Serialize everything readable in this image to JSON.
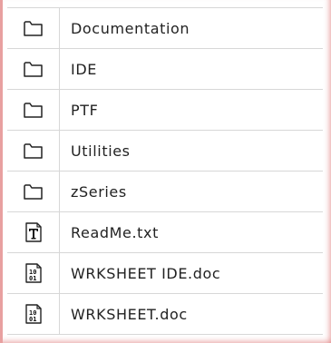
{
  "files": [
    {
      "name": "Documentation",
      "icon": "folder-icon"
    },
    {
      "name": "IDE",
      "icon": "folder-icon"
    },
    {
      "name": "PTF",
      "icon": "folder-icon"
    },
    {
      "name": "Utilities",
      "icon": "folder-icon"
    },
    {
      "name": "zSeries",
      "icon": "folder-icon"
    },
    {
      "name": "ReadMe.txt",
      "icon": "text-file-icon"
    },
    {
      "name": "WRKSHEET IDE.doc",
      "icon": "binary-file-icon"
    },
    {
      "name": "WRKSHEET.doc",
      "icon": "binary-file-icon"
    }
  ],
  "colors": {
    "border": "#d7d7d7",
    "text": "#222222",
    "edge_shadow": "#e8a0a0"
  }
}
